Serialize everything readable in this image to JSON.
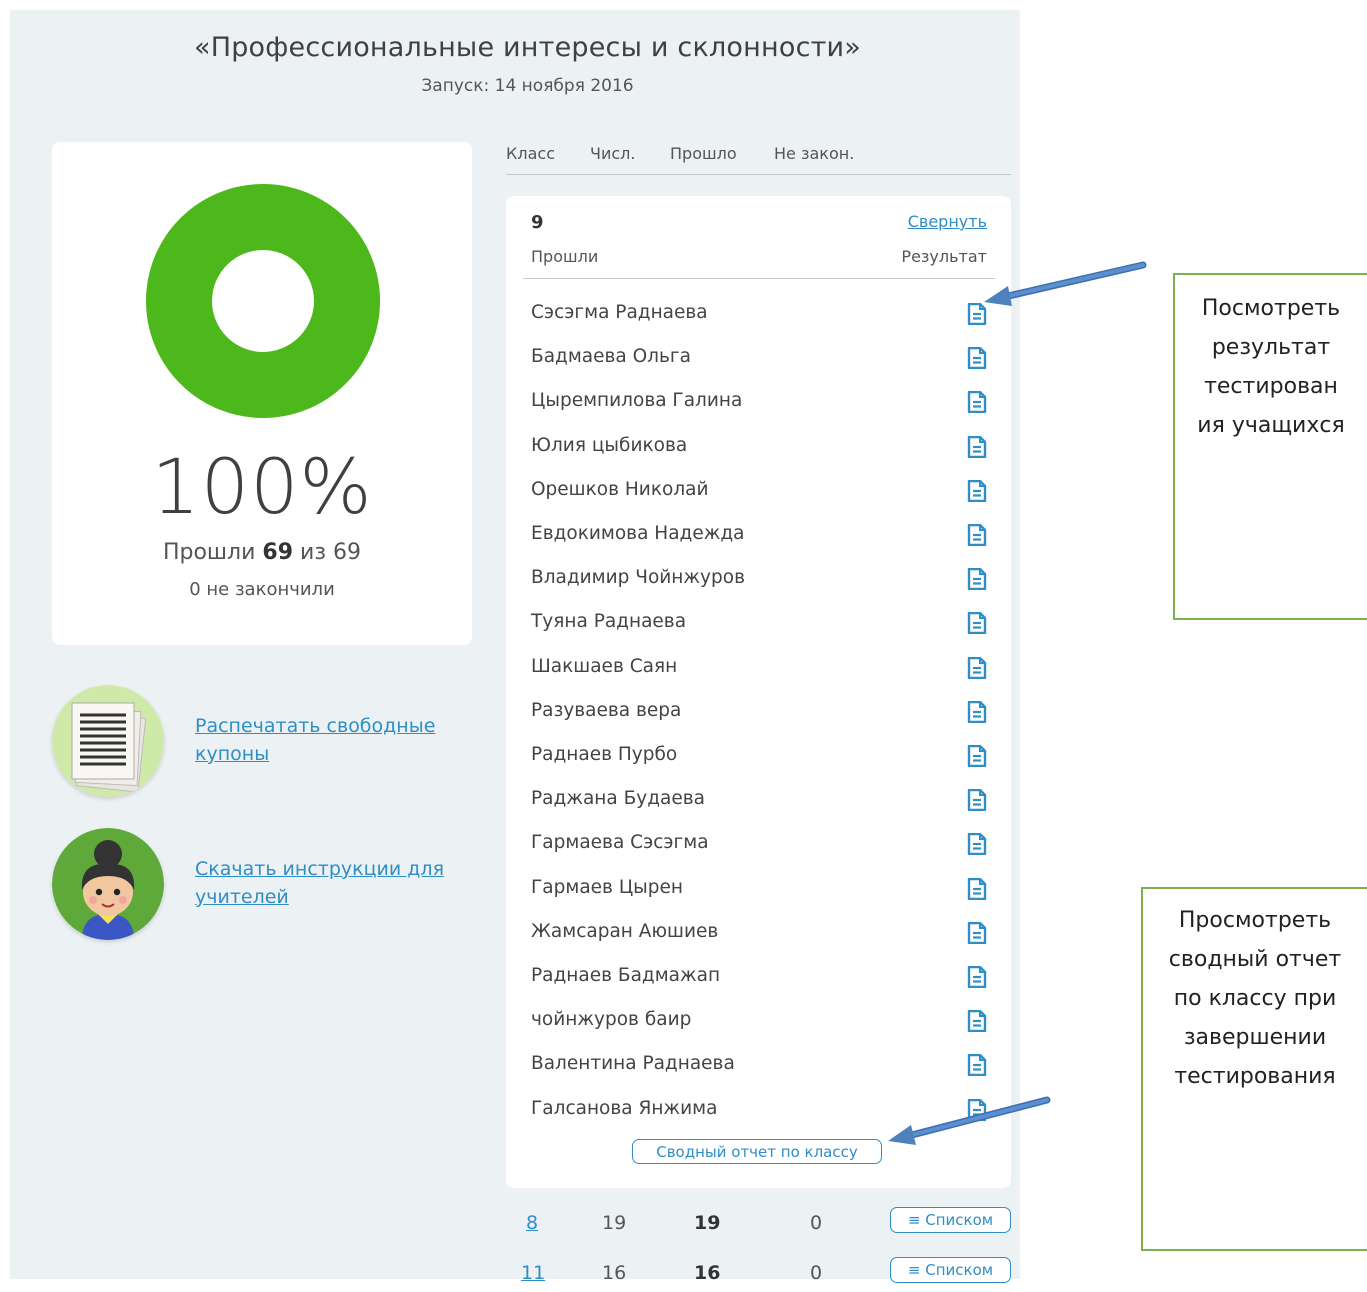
{
  "header": {
    "title": "«Профессиональные интересы и склонности»",
    "subtitle": "Запуск: 14 ноября 2016"
  },
  "stats": {
    "percent_label": "100%",
    "passed_prefix": "Прошли",
    "passed_count": "69",
    "passed_mid": "из",
    "total": "69",
    "not_finished": "0 не закончили",
    "completion": 1.0,
    "donut_color": "#4cb81b"
  },
  "links": {
    "print_coupons": "Распечатать свободные купоны",
    "download_instructions": "Скачать инструкции для учителей"
  },
  "table": {
    "columns": [
      "Класс",
      "Числ.",
      "Прошло",
      "Не закон."
    ]
  },
  "expanded_class": {
    "number": "9",
    "collapse_label": "Свернуть",
    "passed_header": "Прошли",
    "result_header": "Результат",
    "students": [
      "Сэсэгма Раднаева",
      "Бадмаева Ольга",
      "Цыремпилова Галина",
      "Юлия цыбикова",
      "Орешков Николай",
      "Евдокимова Надежда",
      "Владимир Чойнжуров",
      "Туяна Раднаева",
      "Шакшаев Саян",
      "Разуваева вера",
      "Раднаев Пурбо",
      "Раджана Будаева",
      "Гармаева Сэсэгма",
      "Гармаев Цырен",
      "Жамсаран Аюшиев",
      "Раднаев Бадмажап",
      "чойнжуров баир",
      "Валентина Раднаева",
      "Галсанова Янжима"
    ],
    "summary_button": "Сводный отчет по классу"
  },
  "other_classes": [
    {
      "class": "8",
      "count": "19",
      "passed": "19",
      "not_finished": "0",
      "button": "≡ Списком"
    },
    {
      "class": "11",
      "count": "16",
      "passed": "16",
      "not_finished": "0",
      "button": "≡ Списком"
    }
  ],
  "annotations": {
    "view_result": [
      "Посмотреть",
      "результат",
      "тестирован",
      "ия учащихся"
    ],
    "summary_report": [
      "Просмотреть",
      "сводный отчет",
      "по классу при",
      "завершении",
      "тестирования"
    ]
  },
  "colors": {
    "accent": "#2f8ec6",
    "donut": "#4cb81b",
    "annotation_border": "#79b04b",
    "arrow": "#4f81bd"
  }
}
